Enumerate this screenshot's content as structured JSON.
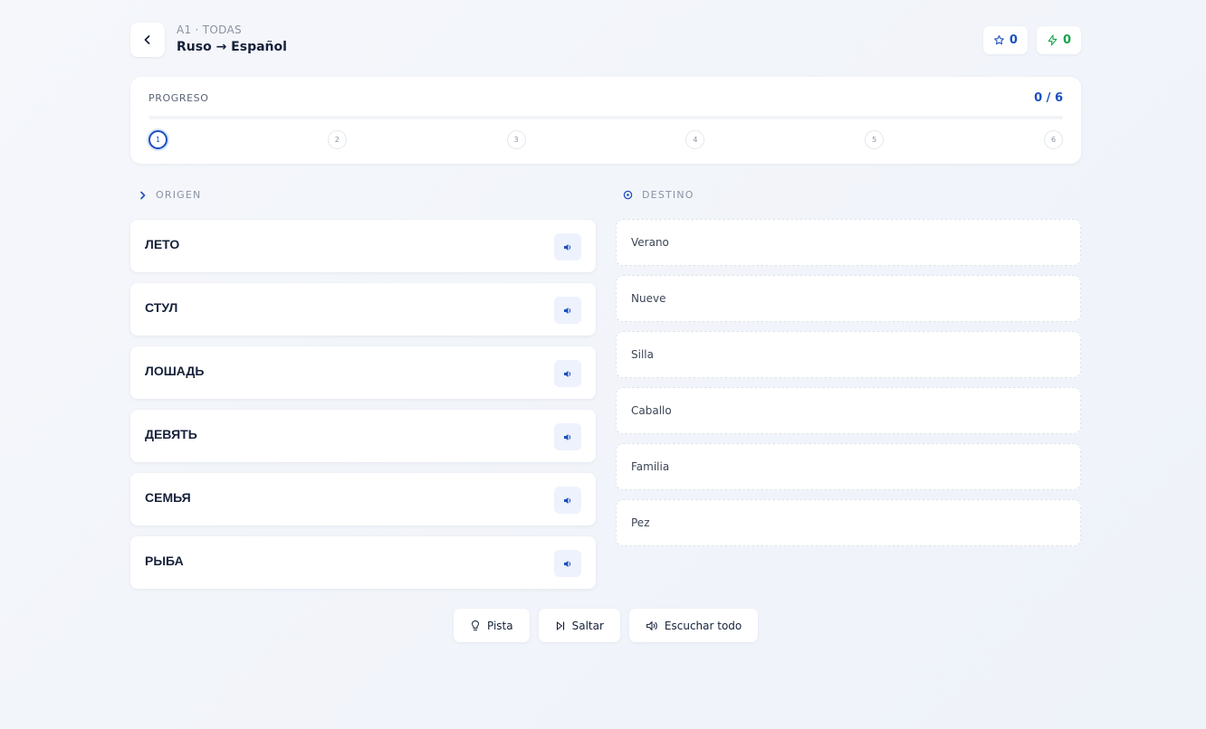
{
  "header": {
    "subtitle": "A1 · TODAS",
    "title": "Ruso → Español",
    "stars": "0",
    "streak": "0"
  },
  "progress": {
    "label": "PROGRESO",
    "count": "0 / 6",
    "fraction": 0,
    "steps": [
      "1",
      "2",
      "3",
      "4",
      "5",
      "6"
    ],
    "active_step": 1
  },
  "columns": {
    "origin_label": "ORIGEN",
    "destination_label": "DESTINO"
  },
  "source_words": [
    "ЛЕТО",
    "СТУЛ",
    "ЛОШАДЬ",
    "ДЕВЯТЬ",
    "СЕМЬЯ",
    "РЫБА"
  ],
  "target_words": [
    "Verano",
    "Nueve",
    "Silla",
    "Caballo",
    "Familia",
    "Pez"
  ],
  "actions": {
    "hint": "Pista",
    "skip": "Saltar",
    "listen_all": "Escuchar todo"
  },
  "colors": {
    "accent": "#1d4fbf",
    "streak": "#16a34a",
    "audio_bg": "#edf2fd"
  }
}
